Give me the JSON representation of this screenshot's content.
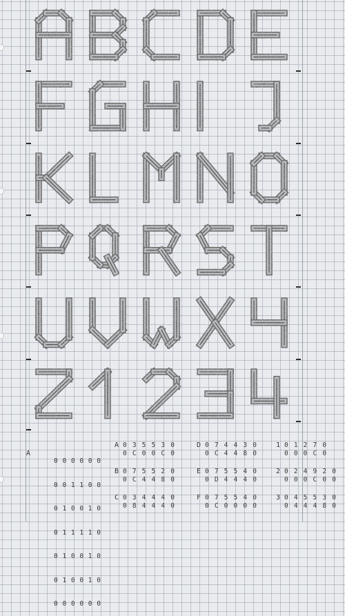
{
  "letters_row1": [
    "A",
    "B",
    "C",
    "D",
    "E"
  ],
  "letters_row2": [
    "F",
    "G",
    "H",
    "I",
    "J"
  ],
  "letters_row3": [
    "K",
    "L",
    "M",
    "N",
    "O"
  ],
  "letters_row4": [
    "P",
    "Q",
    "R",
    "S",
    "T"
  ],
  "letters_row5": [
    "U",
    "V",
    "W",
    "X",
    "Y"
  ],
  "letters_row6": [
    "Z",
    "1",
    "2",
    "3",
    "4"
  ],
  "bitmap_label": "A",
  "bitmap_rows": [
    "0 0 0 0 0 0",
    "0 0 1 1 0 0",
    "0 1 0 0 1 0",
    "0 1 1 1 1 0",
    "0 1 0 0 1 0",
    "0 1 0 0 1 0",
    "0 0 0 0 0 0"
  ],
  "codes": [
    {
      "id": "A",
      "line1": "0 3 5 5 3 0",
      "line2": "0 C 0 0 C 0"
    },
    {
      "id": "B",
      "line1": "0 7 5 5 2 0",
      "line2": "0 C 4 4 8 0"
    },
    {
      "id": "C",
      "line1": "0 3 4 4 4 0",
      "line2": "0 8 4 4 4 0"
    },
    {
      "id": "D",
      "line1": "0 7 4 4 3 0",
      "line2": "0 C 4 4 8 0"
    },
    {
      "id": "E",
      "line1": "0 7 5 5 4 0",
      "line2": "0 D 4 4 4 0"
    },
    {
      "id": "F",
      "line1": "0 7 5 5 4 0",
      "line2": "0 C 0 0 0 0"
    },
    {
      "id": "1",
      "line1": "0 1 2 7 0",
      "line2": "0 0 0 C 0"
    },
    {
      "id": "2",
      "line1": "0 2 4 9 2 0",
      "line2": "0 0 0 C 0 0"
    },
    {
      "id": "3",
      "line1": "0 4 5 5 3 0",
      "line2": "0 4 4 4 8 0"
    }
  ]
}
